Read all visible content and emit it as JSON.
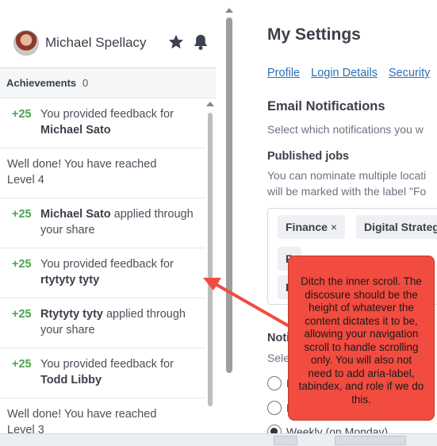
{
  "user": {
    "name": "Michael Spellacy"
  },
  "achievements": {
    "title": "Achievements",
    "count": "0",
    "items": [
      {
        "points": "+25",
        "parts": [
          "You provided feedback for ",
          "Michael Sato",
          ""
        ]
      },
      {
        "points": "",
        "parts": [
          "Well done! You have reached Level 4",
          "",
          ""
        ]
      },
      {
        "points": "+25",
        "parts": [
          "",
          "Michael Sato",
          " applied through your share"
        ]
      },
      {
        "points": "+25",
        "parts": [
          "You provided feedback for ",
          "rtytyty tyty",
          ""
        ]
      },
      {
        "points": "+25",
        "parts": [
          "",
          "Rtytyty tyty",
          " applied through your share"
        ]
      },
      {
        "points": "+25",
        "parts": [
          "You provided feedback for ",
          "Todd Libby",
          ""
        ]
      },
      {
        "points": "",
        "parts": [
          "Well done! You have reached Level 3",
          "",
          ""
        ]
      }
    ]
  },
  "settings": {
    "title": "My Settings",
    "tabs": [
      "Profile",
      "Login Details",
      "Security"
    ],
    "email_title": "Email Notifications",
    "email_desc": "Select which notifications you w",
    "published_title": "Published jobs",
    "published_desc_1": "You can nominate multiple locati",
    "published_desc_2": "will be marked with the label \"Fo",
    "tags": [
      {
        "label": "Finance",
        "remove": "×"
      },
      {
        "label": "Digital Strateg",
        "remove": ""
      },
      {
        "label": "R",
        "remove": ""
      },
      {
        "label": "R",
        "remove": ""
      }
    ],
    "notif_title": "Noti",
    "notif_desc": "Sele",
    "radios": [
      {
        "label": "H",
        "checked": false
      },
      {
        "label": "D",
        "checked": false
      },
      {
        "label": "Weekly (on Monday)",
        "checked": true
      }
    ]
  },
  "annotation": {
    "text": "Ditch the inner scroll. The discosure should be the height of whatever the content dictates it to be, allowing your navigation scroll to handle scrolling only. You will also not need to add aria-label, tabindex, and role if we do this.",
    "color": "#f24b3f"
  }
}
